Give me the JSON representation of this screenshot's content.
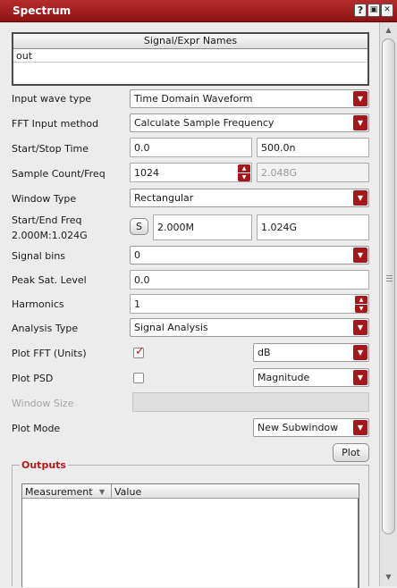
{
  "window": {
    "title": "Spectrum",
    "buttons": {
      "help": "?",
      "restore": "▣",
      "close": "✕"
    }
  },
  "names_table": {
    "header": "Signal/Expr Names",
    "rows": [
      "out"
    ]
  },
  "form": {
    "input_wave_type": {
      "label": "Input wave type",
      "value": "Time Domain Waveform"
    },
    "fft_input_method": {
      "label": "FFT Input method",
      "value": "Calculate Sample Frequency"
    },
    "start_stop_time": {
      "label": "Start/Stop Time",
      "start": "0.0",
      "stop": "500.0n"
    },
    "sample_count_freq": {
      "label": "Sample Count/Freq",
      "count": "1024",
      "freq": "2.048G"
    },
    "window_type": {
      "label": "Window Type",
      "value": "Rectangular"
    },
    "start_end_freq": {
      "label": "Start/End Freq",
      "sublabel": "2.000M:1.024G",
      "s_button": "S",
      "start": "2.000M",
      "end": "1.024G"
    },
    "signal_bins": {
      "label": "Signal bins",
      "value": "0"
    },
    "peak_sat_level": {
      "label": "Peak Sat. Level",
      "value": "0.0"
    },
    "harmonics": {
      "label": "Harmonics",
      "value": "1"
    },
    "analysis_type": {
      "label": "Analysis Type",
      "value": "Signal Analysis"
    },
    "plot_fft": {
      "label": "Plot FFT (Units)",
      "checked": true,
      "units": "dB"
    },
    "plot_psd": {
      "label": "Plot PSD",
      "checked": false,
      "units": "Magnitude"
    },
    "window_size": {
      "label": "Window Size",
      "value": ""
    },
    "plot_mode": {
      "label": "Plot Mode",
      "value": "New Subwindow"
    },
    "plot_button": "Plot"
  },
  "outputs": {
    "title": "Outputs",
    "columns": [
      "Measurement",
      "Value"
    ],
    "rows": []
  },
  "colors": {
    "title_bar": "#9c1c1c",
    "accent": "#a5171b",
    "outputs_title": "#b31b1b"
  }
}
